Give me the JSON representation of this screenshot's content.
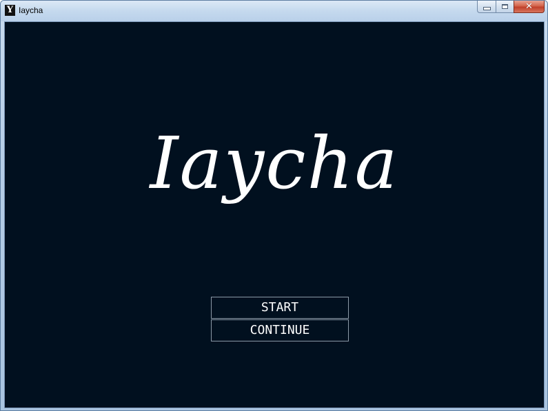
{
  "window": {
    "title": "Iaycha",
    "icon_letter": "Y",
    "close_glyph": "✕"
  },
  "game": {
    "title": "Iaycha",
    "background_color": "#01101f",
    "menu": [
      {
        "label": "START"
      },
      {
        "label": "CONTINUE"
      }
    ]
  }
}
